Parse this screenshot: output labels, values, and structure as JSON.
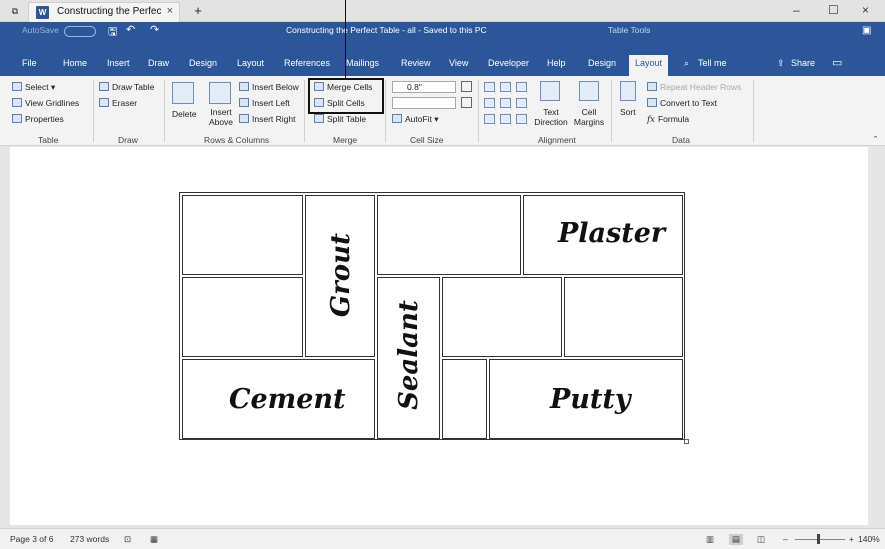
{
  "window": {
    "tab_title": "Constructing the Perfec",
    "tab_close": "×",
    "new_tab": "+",
    "minimize": "–",
    "maximize": "☐",
    "close": "×",
    "doc_title": "Constructing the Perfect Table - all - Saved to this PC",
    "table_tools": "Table Tools",
    "autosave": "AutoSave"
  },
  "menu": {
    "tabs": [
      "File",
      "Home",
      "Insert",
      "Draw",
      "Design",
      "Layout",
      "References",
      "Mailings",
      "Review",
      "View",
      "Developer",
      "Help",
      "Design",
      "Layout"
    ],
    "tell_me": "Tell me",
    "share": "Share"
  },
  "ribbon": {
    "table": {
      "select": "Select ▾",
      "view_gridlines": "View Gridlines",
      "properties": "Properties",
      "label": "Table"
    },
    "draw": {
      "draw_table": "Draw Table",
      "eraser": "Eraser",
      "label": "Draw"
    },
    "rows_cols": {
      "delete": "Delete",
      "insert_above": "Insert Above",
      "insert_below": "Insert Below",
      "insert_left": "Insert Left",
      "insert_right": "Insert Right",
      "label": "Rows & Columns"
    },
    "merge": {
      "merge_cells": "Merge Cells",
      "split_cells": "Split Cells",
      "split_table": "Split Table",
      "label": "Merge"
    },
    "cell_size": {
      "height": "0.8\"",
      "autofit": "AutoFit ▾",
      "label": "Cell Size"
    },
    "alignment": {
      "text_direction": "Text Direction",
      "cell_margins": "Cell Margins",
      "label": "Alignment"
    },
    "data": {
      "sort": "Sort",
      "repeat_header": "Repeat Header Rows",
      "convert": "Convert to Text",
      "formula": "Formula",
      "label": "Data"
    }
  },
  "document": {
    "words": [
      "Grout",
      "Plaster",
      "Sealant",
      "Cement",
      "Putty"
    ]
  },
  "status": {
    "page": "Page 3 of 6",
    "words": "273 words",
    "zoom": "140%"
  }
}
